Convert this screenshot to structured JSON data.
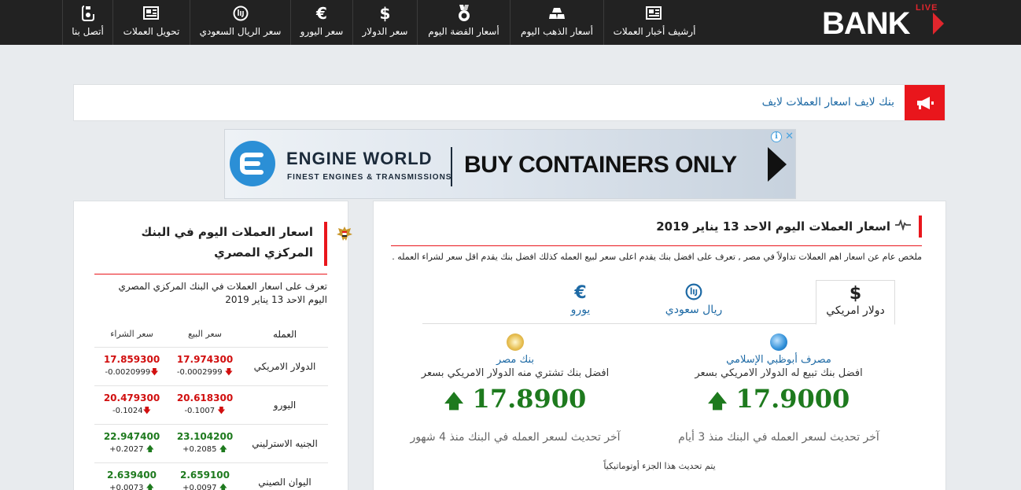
{
  "logo": {
    "live": "LIVE",
    "bank": "BANK"
  },
  "nav": [
    {
      "label": "أرشيف أخبار العملات",
      "icon": "newspaper-icon"
    },
    {
      "label": "أسعار الذهب اليوم",
      "icon": "gold-bars-icon"
    },
    {
      "label": "أسعار الفضة اليوم",
      "icon": "medal-icon"
    },
    {
      "label": "سعر الدولار",
      "icon": "$"
    },
    {
      "label": "سعر اليورو",
      "icon": "€"
    },
    {
      "label": "سعر الريال السعودي",
      "icon": "riyal-icon"
    },
    {
      "label": "تحويل العملات",
      "icon": "newspaper-icon"
    },
    {
      "label": "أتصل بنا",
      "icon": "phone-icon"
    }
  ],
  "ticker": {
    "text": "بنك لايف اسعار العملات لايف"
  },
  "ad": {
    "brand": "ENGINE WORLD",
    "sub": "FINEST ENGINES & TRANSMISSIONS",
    "cta": "BUY CONTAINERS ONLY",
    "info": "i",
    "close": "✕"
  },
  "main": {
    "title": "اسعار العملات اليوم الاحد 13 يناير 2019",
    "summary": "ملخص عام عن اسعار اهم العملات تداولاً في مصر , تعرف على افضل بنك يقدم اعلى سعر لبيع العمله كذلك افضل بنك يقدم اقل سعر لشراء العمله .",
    "tabs": [
      {
        "label": "دولار امريكي",
        "icon": "$",
        "active": true
      },
      {
        "label": "ريال سعودي",
        "icon": "riyal-icon",
        "active": false
      },
      {
        "label": "يورو",
        "icon": "€",
        "active": false
      }
    ],
    "best_sell": {
      "bank": "مصرف أبوظبي الإسلامي",
      "desc": "افضل بنك تبيع له الدولار الامريكي بسعر",
      "price": "17.9000",
      "updated": "آخر تحديث لسعر العمله في البنك منذ 3 أيام"
    },
    "best_buy": {
      "bank": "بنك مصر",
      "desc": "افضل بنك تشتري منه الدولار الامريكي بسعر",
      "price": "17.8900",
      "updated": "آخر تحديث لسعر العمله في البنك منذ 4 شهور"
    },
    "auto_note": "يتم تحديث هذا الجزء أوتوماتيكياً"
  },
  "side": {
    "title": "اسعار العملات اليوم في البنك المركزي المصري",
    "intro": "تعرف على اسعار العملات في البنك المركزي المصري اليوم الاحد 13 يناير 2019",
    "headers": {
      "name": "العمله",
      "sell": "سعر البيع",
      "buy": "سعر الشراء"
    },
    "rows": [
      {
        "name": "الدولار الامريكي",
        "sell": "17.974300",
        "sell_chg": "-0.0002999",
        "buy": "17.859300",
        "buy_chg": "-0.0020999",
        "dir": "down"
      },
      {
        "name": "اليورو",
        "sell": "20.618300",
        "sell_chg": "-0.1007",
        "buy": "20.479300",
        "buy_chg": "-0.1024",
        "dir": "down"
      },
      {
        "name": "الجنيه الاسترليني",
        "sell": "23.104200",
        "sell_chg": "+0.2085",
        "buy": "22.947400",
        "buy_chg": "+0.2027",
        "dir": "up"
      },
      {
        "name": "اليوان الصيني",
        "sell": "2.659100",
        "sell_chg": "+0.0097",
        "buy": "2.639400",
        "buy_chg": "+0.0073",
        "dir": "up"
      }
    ]
  },
  "colors": {
    "accent": "#e9161c",
    "link": "#1e6aa5",
    "up": "#1e7a1e",
    "down": "#d10f0f",
    "nav_bg": "#222222"
  }
}
